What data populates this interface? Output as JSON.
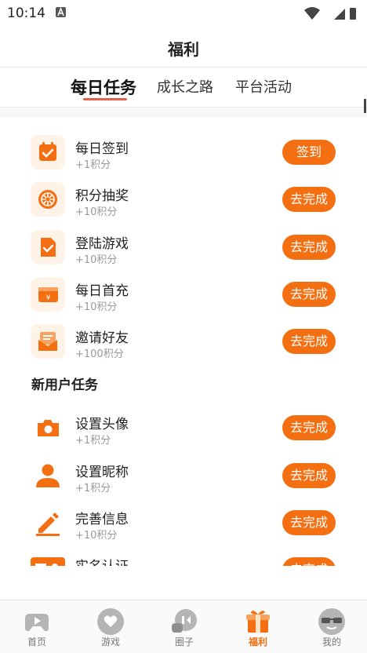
{
  "status_bar": {
    "time": "10:14"
  },
  "header": {
    "title": "福利"
  },
  "tabs": [
    {
      "label": "每日任务",
      "active": true
    },
    {
      "label": "成长之路",
      "active": false
    },
    {
      "label": "平台活动",
      "active": false
    }
  ],
  "daily_tasks": [
    {
      "name": "每日签到",
      "reward": "+1积分",
      "button": "签到",
      "icon": "calendar-check-icon"
    },
    {
      "name": "积分抽奖",
      "reward": "+10积分",
      "button": "去完成",
      "icon": "lottery-wheel-icon"
    },
    {
      "name": "登陆游戏",
      "reward": "+10积分",
      "button": "去完成",
      "icon": "document-check-icon"
    },
    {
      "name": "每日首充",
      "reward": "+10积分",
      "button": "去完成",
      "icon": "wallet-yen-icon"
    },
    {
      "name": "邀请好友",
      "reward": "+100积分",
      "button": "去完成",
      "icon": "invite-mail-icon"
    }
  ],
  "new_user_section": {
    "title": "新用户任务"
  },
  "new_user_tasks": [
    {
      "name": "设置头像",
      "reward": "+1积分",
      "button": "去完成",
      "icon": "camera-icon"
    },
    {
      "name": "设置昵称",
      "reward": "+1积分",
      "button": "去完成",
      "icon": "user-icon"
    },
    {
      "name": "完善信息",
      "reward": "+10积分",
      "button": "去完成",
      "icon": "edit-pen-icon"
    },
    {
      "name": "实名认证",
      "reward": "",
      "button": "去完成",
      "icon": "id-card-icon"
    }
  ],
  "bottom_nav": [
    {
      "label": "首页",
      "icon": "gamepad-icon",
      "active": false
    },
    {
      "label": "游戏",
      "icon": "heart-chat-icon",
      "active": false
    },
    {
      "label": "圈子",
      "icon": "circle-chat-icon",
      "active": false
    },
    {
      "label": "福利",
      "icon": "gift-icon",
      "active": true
    },
    {
      "label": "我的",
      "icon": "sunglasses-face-icon",
      "active": false
    }
  ],
  "colors": {
    "accent": "#f46f12",
    "tab_underline": "#e8604c",
    "icon_bg": "#fff3e8",
    "muted_text": "#999999"
  }
}
